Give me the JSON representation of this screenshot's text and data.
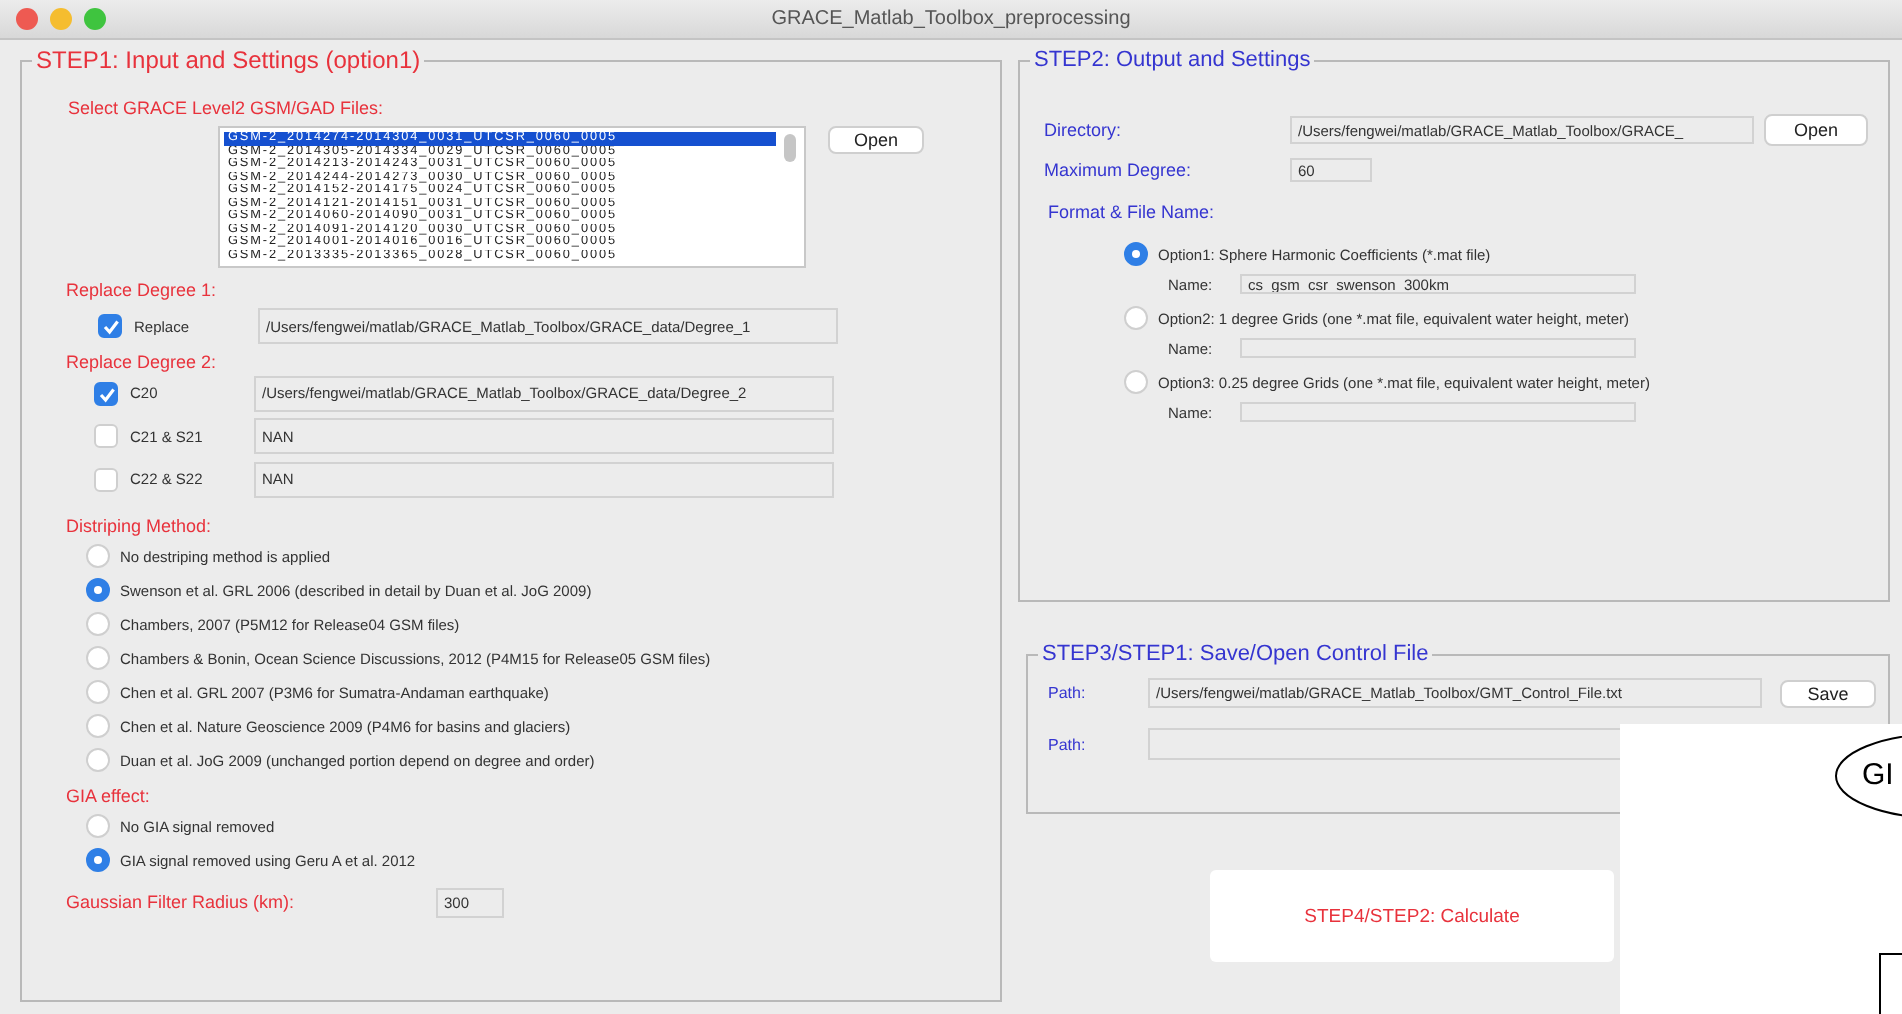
{
  "window": {
    "title": "GRACE_Matlab_Toolbox_preprocessing"
  },
  "step1": {
    "title": "STEP1: Input and Settings (option1)",
    "files_label": "Select GRACE Level2 GSM/GAD Files:",
    "files": [
      {
        "name": "GSM-2_2014274-2014304_0031_UTCSR_0060_0005",
        "selected": true
      },
      {
        "name": "GSM-2_2014305-2014334_0029_UTCSR_0060_0005",
        "selected": false
      },
      {
        "name": "GSM-2_2014213-2014243_0031_UTCSR_0060_0005",
        "selected": false
      },
      {
        "name": "GSM-2_2014244-2014273_0030_UTCSR_0060_0005",
        "selected": false
      },
      {
        "name": "GSM-2_2014152-2014175_0024_UTCSR_0060_0005",
        "selected": false
      },
      {
        "name": "GSM-2_2014121-2014151_0031_UTCSR_0060_0005",
        "selected": false
      },
      {
        "name": "GSM-2_2014060-2014090_0031_UTCSR_0060_0005",
        "selected": false
      },
      {
        "name": "GSM-2_2014091-2014120_0030_UTCSR_0060_0005",
        "selected": false
      },
      {
        "name": "GSM-2_2014001-2014016_0016_UTCSR_0060_0005",
        "selected": false
      },
      {
        "name": "GSM-2_2013335-2013365_0028_UTCSR_0060_0005",
        "selected": false
      }
    ],
    "open_button": "Open",
    "replace_degree1": {
      "label": "Replace Degree 1:",
      "rows": [
        {
          "label": "Replace",
          "checked": true,
          "value": "/Users/fengwei/matlab/GRACE_Matlab_Toolbox/GRACE_data/Degree_1"
        }
      ]
    },
    "replace_degree2": {
      "label": "Replace Degree 2:",
      "rows": [
        {
          "label": "C20",
          "checked": true,
          "value": "/Users/fengwei/matlab/GRACE_Matlab_Toolbox/GRACE_data/Degree_2"
        },
        {
          "label": "C21 & S21",
          "checked": false,
          "value": "NAN"
        },
        {
          "label": "C22 & S22",
          "checked": false,
          "value": "NAN"
        }
      ]
    },
    "destriping": {
      "label": "Distriping Method:",
      "options": [
        {
          "label": "No destriping method is applied",
          "selected": false
        },
        {
          "label": "Swenson et al. GRL 2006 (described in detail by Duan et al. JoG 2009)",
          "selected": true
        },
        {
          "label": "Chambers, 2007 (P5M12 for Release04 GSM files)",
          "selected": false
        },
        {
          "label": "Chambers & Bonin, Ocean Science Discussions, 2012 (P4M15 for Release05 GSM files)",
          "selected": false
        },
        {
          "label": "Chen et al. GRL 2007 (P3M6 for Sumatra-Andaman earthquake)",
          "selected": false
        },
        {
          "label": "Chen et al. Nature Geoscience 2009 (P4M6 for basins and glaciers)",
          "selected": false
        },
        {
          "label": "Duan et al. JoG 2009 (unchanged portion depend on degree and order)",
          "selected": false
        }
      ]
    },
    "gia": {
      "label": "GIA effect:",
      "options": [
        {
          "label": "No GIA signal removed",
          "selected": false
        },
        {
          "label": "GIA signal removed using Geru A et al. 2012",
          "selected": true
        }
      ]
    },
    "gaussian": {
      "label": "Gaussian Filter Radius (km):",
      "value": "300"
    }
  },
  "step2": {
    "title": "STEP2: Output and Settings",
    "directory": {
      "label": "Directory:",
      "value": "/Users/fengwei/matlab/GRACE_Matlab_Toolbox/GRACE_"
    },
    "open_button": "Open",
    "max_degree": {
      "label": "Maximum Degree:",
      "value": "60"
    },
    "format_label": "Format & File Name:",
    "options": [
      {
        "label": "Option1: Sphere Harmonic Coefficients (*.mat file)",
        "selected": true,
        "name_label": "Name:",
        "name_value": "cs_gsm_csr_swenson_300km"
      },
      {
        "label": "Option2: 1 degree Grids (one *.mat file, equivalent water height, meter)",
        "selected": false,
        "name_label": "Name:"
      },
      {
        "label": "Option3: 0.25 degree Grids (one *.mat file, equivalent water height, meter)",
        "selected": false,
        "name_label": "Name:"
      }
    ]
  },
  "step3": {
    "title": "STEP3/STEP1: Save/Open Control File",
    "rows": [
      {
        "label": "Path:",
        "value": "/Users/fengwei/matlab/GRACE_Matlab_Toolbox/GMT_Control_File.txt",
        "button": "Save"
      },
      {
        "label": "Path:"
      }
    ]
  },
  "calculate_button": "STEP4/STEP2: Calculate",
  "overlay": {
    "text": "GI"
  }
}
